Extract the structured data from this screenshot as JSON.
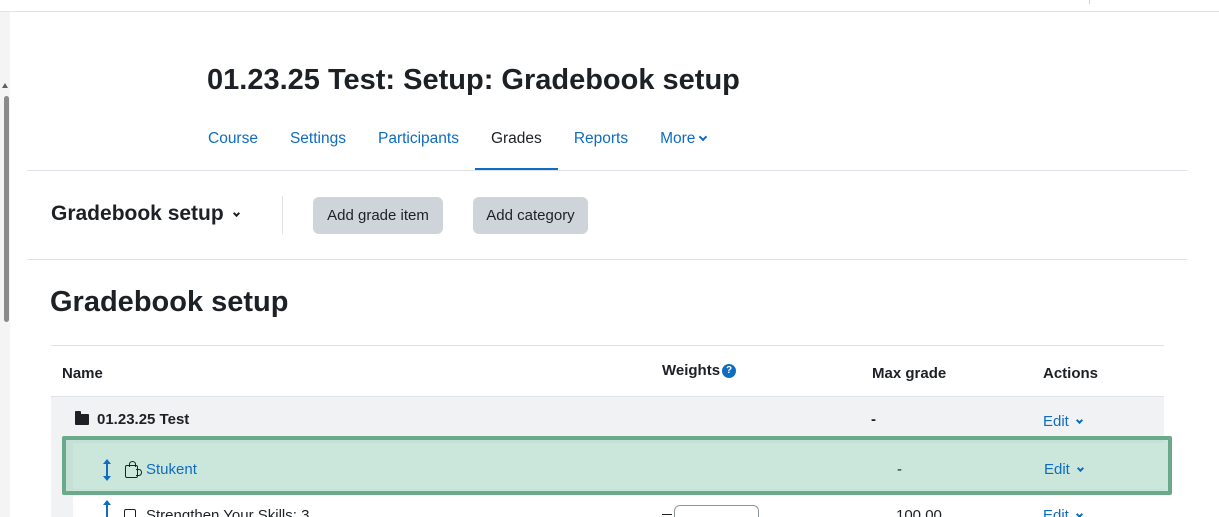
{
  "page": {
    "title": "01.23.25 Test: Setup: Gradebook setup"
  },
  "nav": {
    "items": [
      {
        "label": "Course"
      },
      {
        "label": "Settings"
      },
      {
        "label": "Participants"
      },
      {
        "label": "Grades",
        "active": true
      },
      {
        "label": "Reports"
      },
      {
        "label": "More"
      }
    ]
  },
  "tertiary": {
    "select_label": "Gradebook setup",
    "add_grade_item": "Add grade item",
    "add_category": "Add category"
  },
  "section": {
    "title": "Gradebook setup"
  },
  "table": {
    "headers": {
      "name": "Name",
      "weights": "Weights",
      "max_grade": "Max grade",
      "actions": "Actions"
    },
    "help_icon": "question-circle-icon",
    "rows": [
      {
        "type": "category",
        "icon": "folder-icon",
        "name": "01.23.25 Test",
        "max_grade": "-",
        "action": "Edit"
      },
      {
        "type": "item",
        "icon": "puzzle-icon",
        "name": "Stukent",
        "max_grade": "-",
        "action": "Edit",
        "highlighted": true
      },
      {
        "type": "item",
        "icon": "checkbox-icon",
        "name": "Strengthen Your Skills: 3",
        "max_grade": "100.00",
        "action": "Edit"
      }
    ]
  },
  "colors": {
    "link": "#0f6cbf",
    "highlight_border": "#6aa98a",
    "highlight_fill": "#a0d4be",
    "button_bg": "#ced4da"
  }
}
